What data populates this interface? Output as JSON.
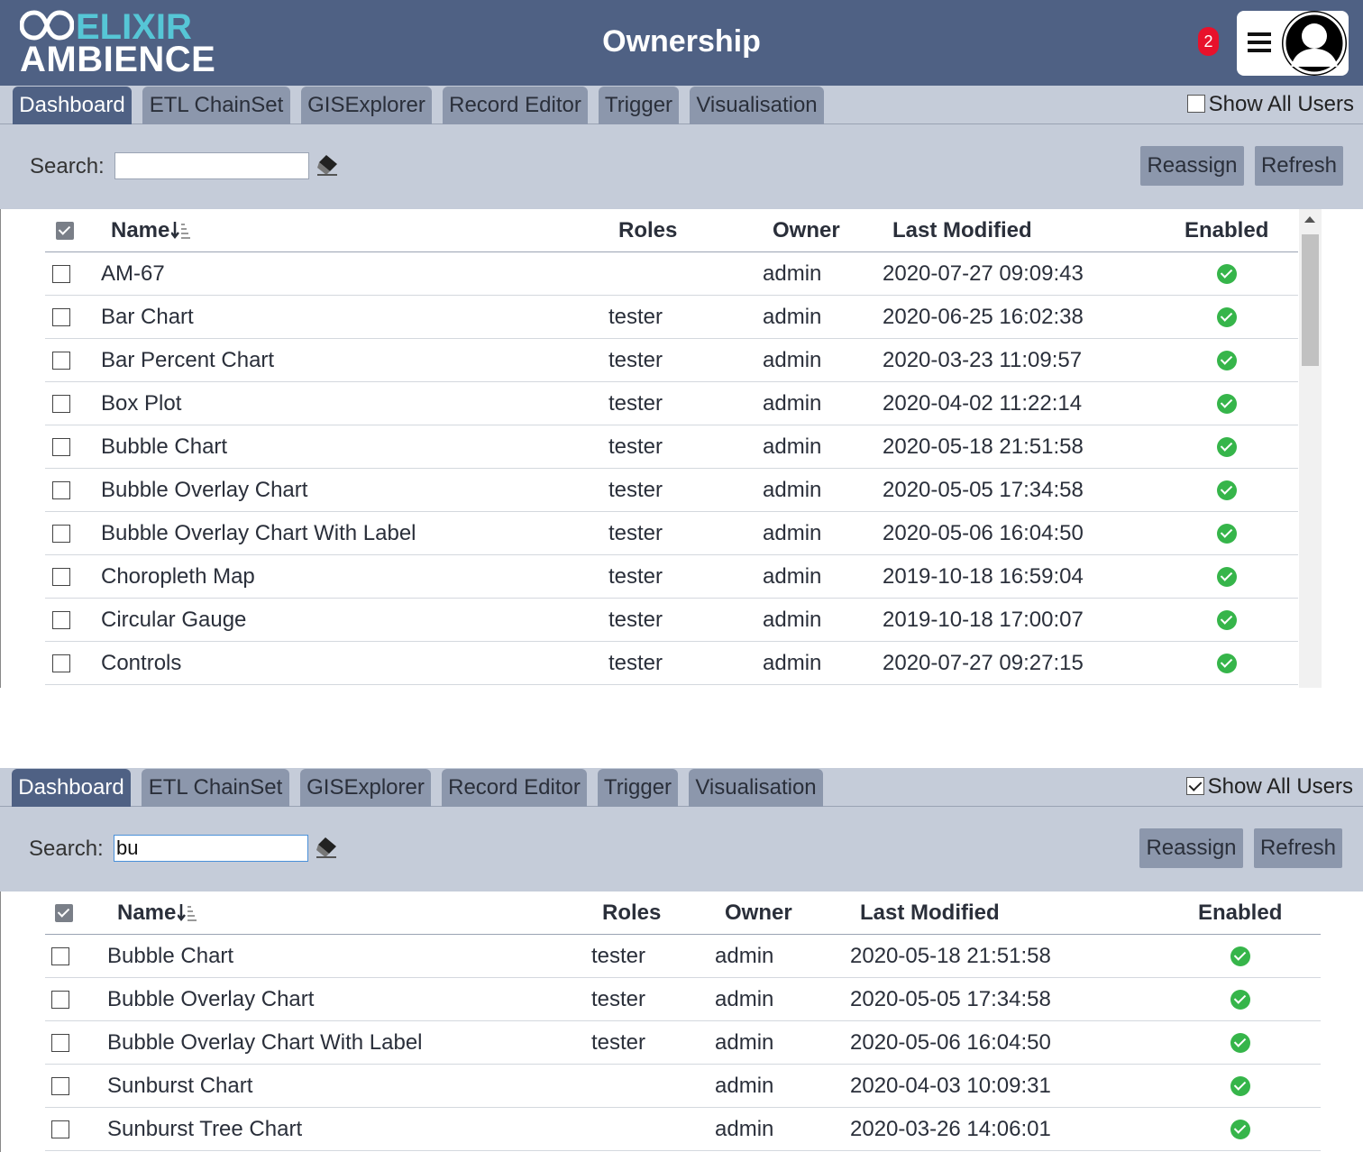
{
  "header": {
    "logo_top": "ELIXIR",
    "logo_bottom": "AMBIENCE",
    "title": "Ownership",
    "notification_count": "2"
  },
  "panel1": {
    "tabs": [
      {
        "label": "Dashboard",
        "active": true
      },
      {
        "label": "ETL ChainSet",
        "active": false
      },
      {
        "label": "GISExplorer",
        "active": false
      },
      {
        "label": "Record Editor",
        "active": false
      },
      {
        "label": "Trigger",
        "active": false
      },
      {
        "label": "Visualisation",
        "active": false
      }
    ],
    "show_all_users": {
      "label": "Show All Users",
      "checked": false
    },
    "search": {
      "label": "Search:",
      "value": ""
    },
    "buttons": {
      "reassign": "Reassign",
      "refresh": "Refresh"
    },
    "columns": {
      "name": "Name",
      "roles": "Roles",
      "owner": "Owner",
      "last_modified": "Last Modified",
      "enabled": "Enabled"
    },
    "rows": [
      {
        "name": "AM-67",
        "roles": "",
        "owner": "admin",
        "modified": "2020-07-27 09:09:43",
        "enabled": true
      },
      {
        "name": "Bar Chart",
        "roles": "tester",
        "owner": "admin",
        "modified": "2020-06-25 16:02:38",
        "enabled": true
      },
      {
        "name": "Bar Percent Chart",
        "roles": "tester",
        "owner": "admin",
        "modified": "2020-03-23 11:09:57",
        "enabled": true
      },
      {
        "name": "Box Plot",
        "roles": "tester",
        "owner": "admin",
        "modified": "2020-04-02 11:22:14",
        "enabled": true
      },
      {
        "name": "Bubble Chart",
        "roles": "tester",
        "owner": "admin",
        "modified": "2020-05-18 21:51:58",
        "enabled": true
      },
      {
        "name": "Bubble Overlay Chart",
        "roles": "tester",
        "owner": "admin",
        "modified": "2020-05-05 17:34:58",
        "enabled": true
      },
      {
        "name": "Bubble Overlay Chart With Label",
        "roles": "tester",
        "owner": "admin",
        "modified": "2020-05-06 16:04:50",
        "enabled": true
      },
      {
        "name": "Choropleth Map",
        "roles": "tester",
        "owner": "admin",
        "modified": "2019-10-18 16:59:04",
        "enabled": true
      },
      {
        "name": "Circular Gauge",
        "roles": "tester",
        "owner": "admin",
        "modified": "2019-10-18 17:00:07",
        "enabled": true
      },
      {
        "name": "Controls",
        "roles": "tester",
        "owner": "admin",
        "modified": "2020-07-27 09:27:15",
        "enabled": true
      }
    ]
  },
  "panel2": {
    "tabs": [
      {
        "label": "Dashboard",
        "active": true
      },
      {
        "label": "ETL ChainSet",
        "active": false
      },
      {
        "label": "GISExplorer",
        "active": false
      },
      {
        "label": "Record Editor",
        "active": false
      },
      {
        "label": "Trigger",
        "active": false
      },
      {
        "label": "Visualisation",
        "active": false
      }
    ],
    "show_all_users": {
      "label": "Show All Users",
      "checked": true
    },
    "search": {
      "label": "Search:",
      "value": "bu"
    },
    "buttons": {
      "reassign": "Reassign",
      "refresh": "Refresh"
    },
    "columns": {
      "name": "Name",
      "roles": "Roles",
      "owner": "Owner",
      "last_modified": "Last Modified",
      "enabled": "Enabled"
    },
    "rows": [
      {
        "name": "Bubble Chart",
        "roles": "tester",
        "owner": "admin",
        "modified": "2020-05-18 21:51:58",
        "enabled": true
      },
      {
        "name": "Bubble Overlay Chart",
        "roles": "tester",
        "owner": "admin",
        "modified": "2020-05-05 17:34:58",
        "enabled": true
      },
      {
        "name": "Bubble Overlay Chart With Label",
        "roles": "tester",
        "owner": "admin",
        "modified": "2020-05-06 16:04:50",
        "enabled": true
      },
      {
        "name": "Sunburst Chart",
        "roles": "",
        "owner": "admin",
        "modified": "2020-04-03 10:09:31",
        "enabled": true
      },
      {
        "name": "Sunburst Tree Chart",
        "roles": "",
        "owner": "admin",
        "modified": "2020-03-26 14:06:01",
        "enabled": true
      }
    ]
  }
}
